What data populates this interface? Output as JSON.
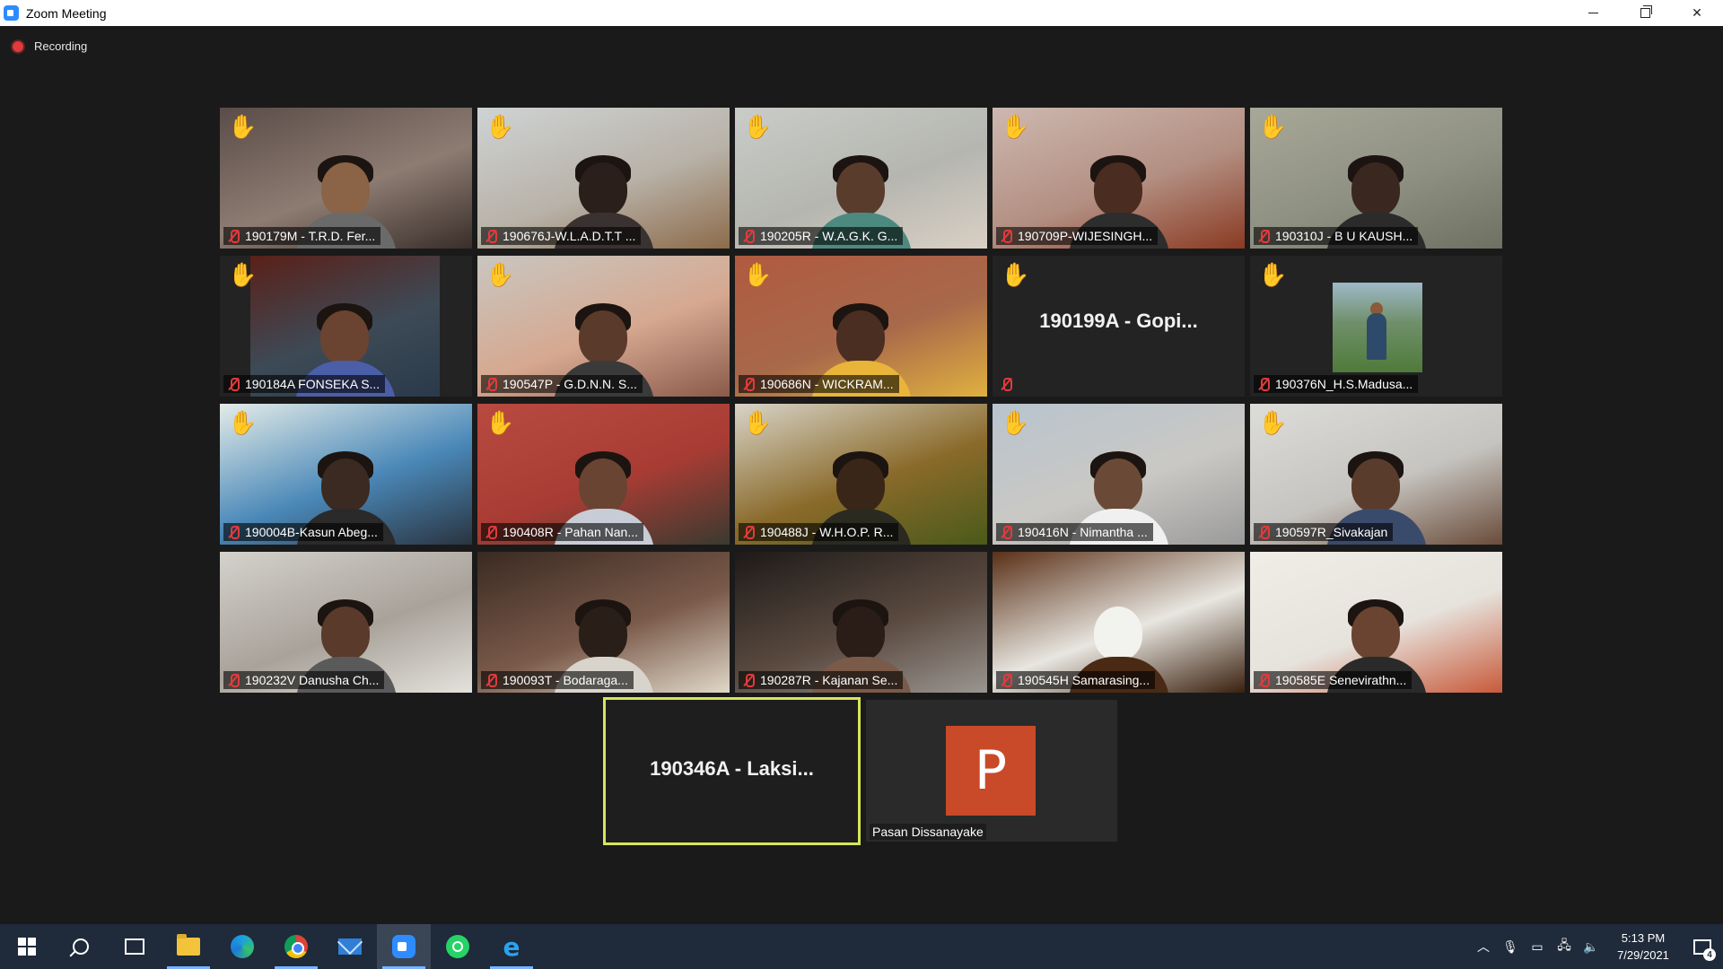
{
  "window": {
    "title": "Zoom Meeting"
  },
  "recording": {
    "label": "Recording"
  },
  "participants": [
    {
      "name": "190179M - T.R.D. Fer...",
      "hand_raised": true,
      "muted": true
    },
    {
      "name": "190676J-W.L.A.D.T.T ...",
      "hand_raised": true,
      "muted": true
    },
    {
      "name": "190205R - W.A.G.K. G...",
      "hand_raised": true,
      "muted": true
    },
    {
      "name": "190709P-WIJESINGH...",
      "hand_raised": true,
      "muted": true
    },
    {
      "name": "190310J - B U KAUSH...",
      "hand_raised": true,
      "muted": true
    },
    {
      "name": "190184A FONSEKA S...",
      "hand_raised": true,
      "muted": true
    },
    {
      "name": "190547P - G.D.N.N. S...",
      "hand_raised": true,
      "muted": true
    },
    {
      "name": "190686N - WICKRAM...",
      "hand_raised": true,
      "muted": true
    },
    {
      "name": "",
      "display_name": "190199A - Gopi...",
      "hand_raised": true,
      "muted": true,
      "video": false
    },
    {
      "name": "190376N_H.S.Madusa...",
      "hand_raised": true,
      "muted": true,
      "video": false
    },
    {
      "name": "190004B-Kasun Abeg...",
      "hand_raised": true,
      "muted": true
    },
    {
      "name": "190408R - Pahan Nan...",
      "hand_raised": true,
      "muted": true
    },
    {
      "name": "190488J - W.H.O.P. R...",
      "hand_raised": true,
      "muted": true
    },
    {
      "name": "190416N - Nimantha ...",
      "hand_raised": true,
      "muted": true
    },
    {
      "name": "190597R_Sivakajan",
      "hand_raised": true,
      "muted": true
    },
    {
      "name": "190232V Danusha Ch...",
      "hand_raised": false,
      "muted": true
    },
    {
      "name": "190093T - Bodaraga...",
      "hand_raised": false,
      "muted": true
    },
    {
      "name": "190287R - Kajanan Se...",
      "hand_raised": false,
      "muted": true
    },
    {
      "name": "190545H Samarasing...",
      "hand_raised": false,
      "muted": true
    },
    {
      "name": "190585E Senevirathn...",
      "hand_raised": false,
      "muted": true
    }
  ],
  "active_speaker": {
    "display_name": "190346A - Laksi..."
  },
  "presenter": {
    "name": "Pasan Dissanayake",
    "avatar_letter": "P"
  },
  "taskbar": {
    "apps": [
      "start-icon",
      "search-icon",
      "task-view-icon",
      "file-explorer-icon",
      "edge-icon",
      "chrome-icon",
      "mail-icon",
      "zoom-icon",
      "whatsapp-icon",
      "internet-explorer-icon"
    ],
    "clock": {
      "time": "5:13 PM",
      "date": "7/29/2021"
    },
    "notification_count": "4"
  },
  "colors": {
    "background": "#1a1a1a",
    "active_border": "#d6e65a",
    "mute_red": "#e23b3b",
    "hand_yellow": "#f4c63a",
    "ppt_orange": "#c94a28",
    "taskbar": "#1f2a3a"
  }
}
